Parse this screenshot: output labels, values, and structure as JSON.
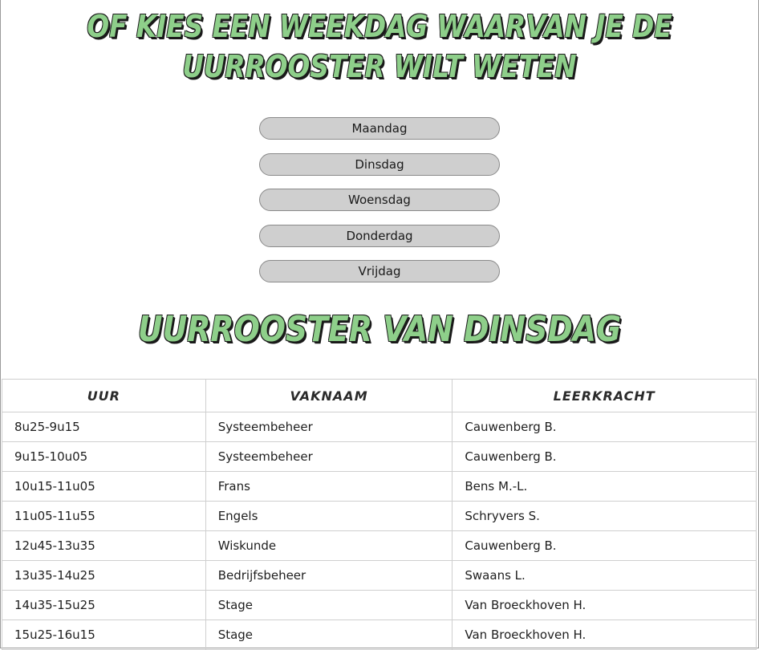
{
  "headings": {
    "choose_day": "of kies een weekdag waarvan je de uurrooster wilt weten",
    "schedule_title": "Uurrooster van Dinsdag"
  },
  "days": [
    "Maandag",
    "Dinsdag",
    "Woensdag",
    "Donderdag",
    "Vrijdag"
  ],
  "schedule": {
    "columns": [
      "Uur",
      "Vaknaam",
      "Leerkracht"
    ],
    "rows": [
      [
        "8u25-9u15",
        "Systeembeheer",
        "Cauwenberg B."
      ],
      [
        "9u15-10u05",
        "Systeembeheer",
        "Cauwenberg B."
      ],
      [
        "10u15-11u05",
        "Frans",
        "Bens M.-L."
      ],
      [
        "11u05-11u55",
        "Engels",
        "Schryvers S."
      ],
      [
        "12u45-13u35",
        "Wiskunde",
        "Cauwenberg B."
      ],
      [
        "13u35-14u25",
        "Bedrijfsbeheer",
        "Swaans L."
      ],
      [
        "14u35-15u25",
        "Stage",
        "Van Broeckhoven H."
      ],
      [
        "15u25-16u15",
        "Stage",
        "Van Broeckhoven H."
      ]
    ]
  },
  "colors": {
    "heading_fill": "#8ecf8a",
    "heading_outline": "#1a1a1a",
    "button_bg": "#cfcfcf",
    "table_border": "#cfcfcf"
  }
}
